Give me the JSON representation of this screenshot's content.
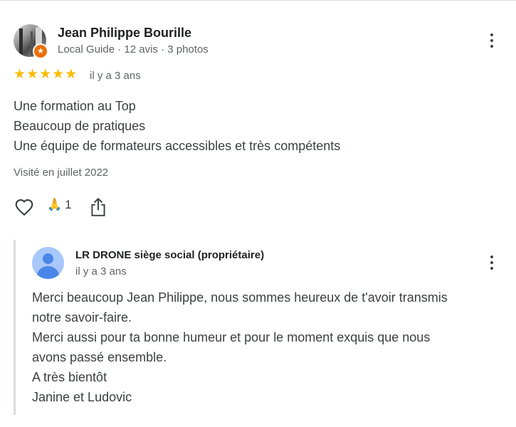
{
  "review": {
    "author_name": "Jean Philippe Bourille",
    "author_meta": "Local Guide · 12 avis · 3 photos",
    "rating": 5,
    "stars": [
      "★",
      "★",
      "★",
      "★",
      "★"
    ],
    "time": "il y a 3 ans",
    "text_lines": [
      "Une formation au Top",
      "Beaucoup de pratiques",
      "Une équipe de formateurs accessibles et très compétents"
    ],
    "visited": "Visité en juillet 2022",
    "reaction_emoji": "🙏",
    "reaction_count": "1",
    "badge_icon": "★"
  },
  "reply": {
    "owner_name": "LR DRONE siège social (propriétaire)",
    "time": "il y a 3 ans",
    "text_lines": [
      "Merci beaucoup Jean Philippe, nous sommes heureux de t'avoir transmis",
      "notre savoir-faire.",
      "Merci aussi pour ta bonne humeur et pour le moment exquis que nous",
      "avons passé ensemble.",
      "A très bientôt",
      "Janine et Ludovic"
    ]
  },
  "colors": {
    "star": "#fbbc04",
    "local_guide_badge": "#e8710a",
    "owner_avatar_bg": "#a8c7fa",
    "owner_avatar_fg": "#4a86e8",
    "secondary_text": "#5f6368"
  },
  "icons": {
    "more": "more-vert-icon",
    "like": "heart-outline-icon",
    "share": "share-icon",
    "star": "star-icon",
    "guide": "local-guide-badge-icon",
    "owner": "person-placeholder-icon"
  }
}
